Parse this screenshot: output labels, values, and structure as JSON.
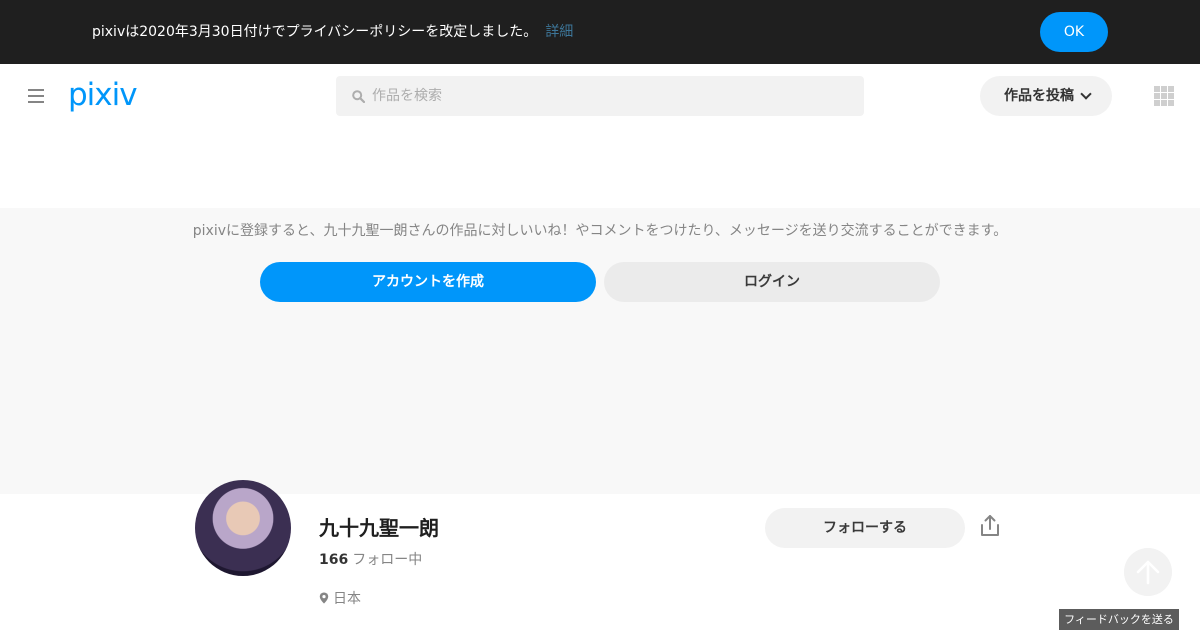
{
  "notice": {
    "message": "pixivは2020年3月30日付けでプライバシーポリシーを改定しました。",
    "link_label": "詳細",
    "ok_label": "OK"
  },
  "header": {
    "logo_text": "pixiv",
    "search_placeholder": "作品を検索",
    "post_label": "作品を投稿",
    "icons": [
      "menu-icon",
      "search-icon",
      "chevron-down-icon",
      "apps-icon"
    ]
  },
  "prompt": {
    "text": "pixivに登録すると、九十九聖一朗さんの作品に対しいいね！やコメントをつけたり、メッセージを送り交流することができます。",
    "create_label": "アカウントを作成",
    "login_label": "ログイン"
  },
  "profile": {
    "name": "九十九聖一朗",
    "following_count": "166",
    "following_label": "フォロー中",
    "location": "日本",
    "follow_label": "フォローする",
    "icons": [
      "pin-icon",
      "share-icon"
    ]
  },
  "feedback_label": "フィードバックを送る",
  "colors": {
    "accent": "#0096fa",
    "banner": "#1f1f1f",
    "link": "#3d7699"
  }
}
